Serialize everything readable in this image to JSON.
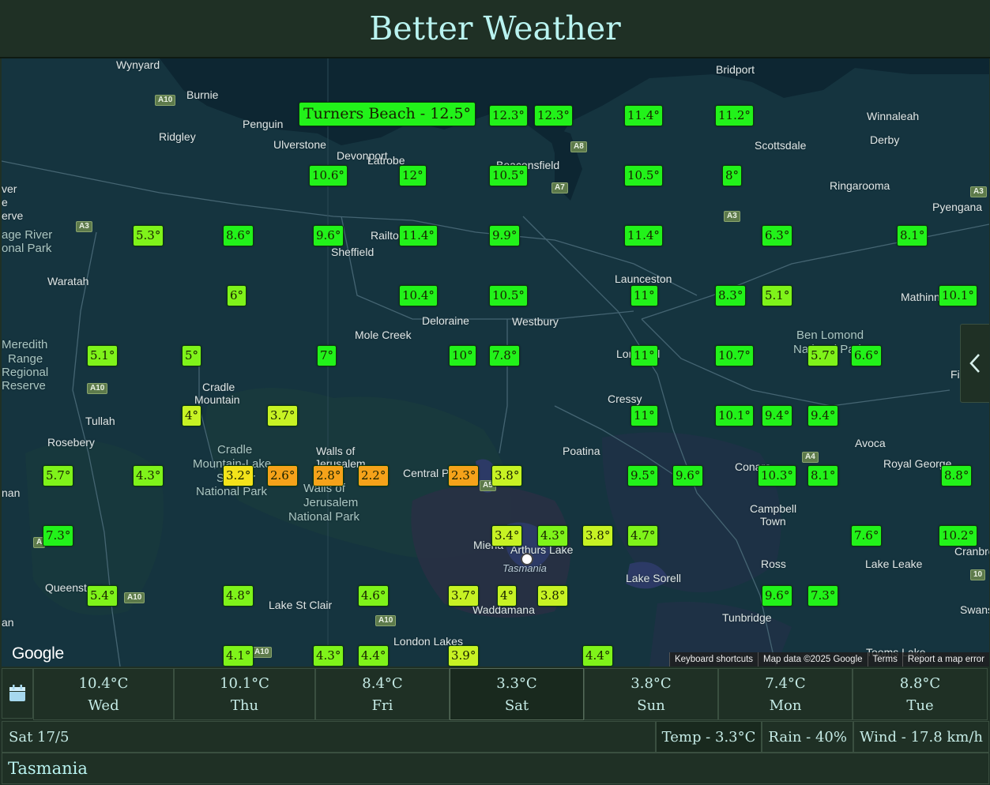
{
  "app": {
    "title": "Better Weather"
  },
  "map": {
    "colors": {
      "water": "#0f2a36",
      "land": "#12313c",
      "marker_green": "#22f21a",
      "marker_lime": "#7ff31a",
      "marker_yellowgreen": "#c7f224",
      "marker_yellow": "#f3e31a",
      "marker_orange": "#f5a21a"
    },
    "place_labels": [
      {
        "text": "Wynyard",
        "kind": "town"
      },
      {
        "text": "Burnie",
        "kind": "town"
      },
      {
        "text": "Penguin",
        "kind": "town"
      },
      {
        "text": "Ridgley",
        "kind": "town"
      },
      {
        "text": "Ulverstone",
        "kind": "town"
      },
      {
        "text": "Devonport",
        "kind": "town"
      },
      {
        "text": "Latrobe",
        "kind": "town"
      },
      {
        "text": "Beaconsfield",
        "kind": "town"
      },
      {
        "text": "Bridport",
        "kind": "town"
      },
      {
        "text": "Winnaleah",
        "kind": "town"
      },
      {
        "text": "Derby",
        "kind": "town"
      },
      {
        "text": "Scottsdale",
        "kind": "town"
      },
      {
        "text": "Ringarooma",
        "kind": "town"
      },
      {
        "text": "Pyengana",
        "kind": "town"
      },
      {
        "text": "ver",
        "kind": "town"
      },
      {
        "text": "e",
        "kind": "town"
      },
      {
        "text": "erve",
        "kind": "town"
      },
      {
        "text": "age River",
        "kind": "park"
      },
      {
        "text": "onal Park",
        "kind": "park"
      },
      {
        "text": "Railton",
        "kind": "town"
      },
      {
        "text": "Sheffield",
        "kind": "town"
      },
      {
        "text": "Waratah",
        "kind": "town"
      },
      {
        "text": "Launceston",
        "kind": "town"
      },
      {
        "text": "Mathinna",
        "kind": "town"
      },
      {
        "text": "Deloraine",
        "kind": "town"
      },
      {
        "text": "Westbury",
        "kind": "town"
      },
      {
        "text": "Mole Creek",
        "kind": "town"
      },
      {
        "text": "Ben Lomond",
        "kind": "park"
      },
      {
        "text": "National Park",
        "kind": "park"
      },
      {
        "text": "Meredith",
        "kind": "park"
      },
      {
        "text": "Range",
        "kind": "park"
      },
      {
        "text": "Regional",
        "kind": "park"
      },
      {
        "text": "Reserve",
        "kind": "park"
      },
      {
        "text": "Fingal",
        "kind": "town"
      },
      {
        "text": "Longford",
        "kind": "town"
      },
      {
        "text": "Cradle",
        "kind": "town"
      },
      {
        "text": "Mountain",
        "kind": "town"
      },
      {
        "text": "Tullah",
        "kind": "town"
      },
      {
        "text": "Cressy",
        "kind": "town"
      },
      {
        "text": "Rosebery",
        "kind": "town"
      },
      {
        "text": "Avoca",
        "kind": "town"
      },
      {
        "text": "Cradle",
        "kind": "park"
      },
      {
        "text": "Mountain-Lake",
        "kind": "park"
      },
      {
        "text": "St Clair",
        "kind": "park"
      },
      {
        "text": "National Park",
        "kind": "park"
      },
      {
        "text": "Walls of",
        "kind": "town"
      },
      {
        "text": "Jerusalem",
        "kind": "town"
      },
      {
        "text": "Walls of",
        "kind": "park"
      },
      {
        "text": "Jerusalem",
        "kind": "park"
      },
      {
        "text": "National Park",
        "kind": "park"
      },
      {
        "text": "Central Plateau",
        "kind": "town"
      },
      {
        "text": "Poatina",
        "kind": "town"
      },
      {
        "text": "Conara",
        "kind": "town"
      },
      {
        "text": "Royal George",
        "kind": "town"
      },
      {
        "text": "Campbell",
        "kind": "town"
      },
      {
        "text": "Town",
        "kind": "town"
      },
      {
        "text": "nan",
        "kind": "town"
      },
      {
        "text": "Miena",
        "kind": "town"
      },
      {
        "text": "Arthurs Lake",
        "kind": "town"
      },
      {
        "text": "Tasmania",
        "kind": "lake"
      },
      {
        "text": "Ross",
        "kind": "town"
      },
      {
        "text": "Lake Leake",
        "kind": "town"
      },
      {
        "text": "Cranbrook",
        "kind": "town"
      },
      {
        "text": "Lake Sorell",
        "kind": "town"
      },
      {
        "text": "Queenstown",
        "kind": "town"
      },
      {
        "text": "Lake St Clair",
        "kind": "town"
      },
      {
        "text": "Waddamana",
        "kind": "town"
      },
      {
        "text": "Tunbridge",
        "kind": "town"
      },
      {
        "text": "Swansea",
        "kind": "town"
      },
      {
        "text": "an",
        "kind": "town"
      },
      {
        "text": "London Lakes",
        "kind": "town"
      },
      {
        "text": "Tooms Lake",
        "kind": "town"
      }
    ],
    "road_shields": [
      "A10",
      "A8",
      "A7",
      "A3",
      "A3",
      "A10",
      "A10",
      "A5",
      "A4",
      "A10",
      "A3",
      "10",
      "A10",
      "A"
    ],
    "selected_location": {
      "label": "Turners Beach - 12.5°"
    },
    "markers": [
      {
        "label": "12.3°",
        "level": "green"
      },
      {
        "label": "12.3°",
        "level": "green"
      },
      {
        "label": "11.4°",
        "level": "green"
      },
      {
        "label": "11.2°",
        "level": "green"
      },
      {
        "label": "10.6°",
        "level": "green"
      },
      {
        "label": "12°",
        "level": "green"
      },
      {
        "label": "10.5°",
        "level": "green"
      },
      {
        "label": "10.5°",
        "level": "green"
      },
      {
        "label": "8°",
        "level": "green"
      },
      {
        "label": "5.3°",
        "level": "lime"
      },
      {
        "label": "8.6°",
        "level": "green"
      },
      {
        "label": "9.6°",
        "level": "green"
      },
      {
        "label": "11.4°",
        "level": "green"
      },
      {
        "label": "9.9°",
        "level": "green"
      },
      {
        "label": "11.4°",
        "level": "green"
      },
      {
        "label": "6.3°",
        "level": "green"
      },
      {
        "label": "8.1°",
        "level": "green"
      },
      {
        "label": "6°",
        "level": "lime"
      },
      {
        "label": "10.4°",
        "level": "green"
      },
      {
        "label": "10.5°",
        "level": "green"
      },
      {
        "label": "11°",
        "level": "green"
      },
      {
        "label": "8.3°",
        "level": "green"
      },
      {
        "label": "5.1°",
        "level": "lime"
      },
      {
        "label": "10.1°",
        "level": "green"
      },
      {
        "label": "5.1°",
        "level": "lime"
      },
      {
        "label": "5°",
        "level": "lime"
      },
      {
        "label": "7°",
        "level": "green"
      },
      {
        "label": "10°",
        "level": "green"
      },
      {
        "label": "7.8°",
        "level": "green"
      },
      {
        "label": "11°",
        "level": "green"
      },
      {
        "label": "10.7°",
        "level": "green"
      },
      {
        "label": "5.7°",
        "level": "lime"
      },
      {
        "label": "6.6°",
        "level": "green"
      },
      {
        "label": "4°",
        "level": "yellowgreen"
      },
      {
        "label": "3.7°",
        "level": "yellowgreen"
      },
      {
        "label": "11°",
        "level": "green"
      },
      {
        "label": "10.1°",
        "level": "green"
      },
      {
        "label": "9.4°",
        "level": "green"
      },
      {
        "label": "9.4°",
        "level": "green"
      },
      {
        "label": "5.7°",
        "level": "lime"
      },
      {
        "label": "4.3°",
        "level": "lime"
      },
      {
        "label": "3.2°",
        "level": "yellow"
      },
      {
        "label": "2.6°",
        "level": "orange"
      },
      {
        "label": "2.8°",
        "level": "orange"
      },
      {
        "label": "2.2°",
        "level": "orange"
      },
      {
        "label": "2.3°",
        "level": "orange"
      },
      {
        "label": "3.8°",
        "level": "yellowgreen"
      },
      {
        "label": "9.5°",
        "level": "green"
      },
      {
        "label": "9.6°",
        "level": "green"
      },
      {
        "label": "10.3°",
        "level": "green"
      },
      {
        "label": "8.1°",
        "level": "green"
      },
      {
        "label": "8.8°",
        "level": "green"
      },
      {
        "label": "7.3°",
        "level": "green"
      },
      {
        "label": "3.4°",
        "level": "yellowgreen"
      },
      {
        "label": "4.3°",
        "level": "lime"
      },
      {
        "label": "3.8°",
        "level": "yellowgreen"
      },
      {
        "label": "4.7°",
        "level": "lime"
      },
      {
        "label": "7.6°",
        "level": "green"
      },
      {
        "label": "10.2°",
        "level": "green"
      },
      {
        "label": "5.4°",
        "level": "lime"
      },
      {
        "label": "4.8°",
        "level": "lime"
      },
      {
        "label": "4.6°",
        "level": "lime"
      },
      {
        "label": "3.7°",
        "level": "yellowgreen"
      },
      {
        "label": "4°",
        "level": "yellowgreen"
      },
      {
        "label": "3.8°",
        "level": "yellowgreen"
      },
      {
        "label": "9.6°",
        "level": "green"
      },
      {
        "label": "7.3°",
        "level": "green"
      },
      {
        "label": "4.1°",
        "level": "lime"
      },
      {
        "label": "4.3°",
        "level": "lime"
      },
      {
        "label": "4.4°",
        "level": "lime"
      },
      {
        "label": "3.9°",
        "level": "yellowgreen"
      },
      {
        "label": "4.4°",
        "level": "lime"
      }
    ],
    "google_logo": "Google",
    "attribution": {
      "shortcuts": "Keyboard shortcuts",
      "map_data": "Map data ©2025 Google",
      "terms": "Terms",
      "report": "Report a map error"
    },
    "side_toggle_icon": "chevron-left-icon"
  },
  "forecast": {
    "calendar_icon": "calendar-icon",
    "days": [
      {
        "temp": "10.4°C",
        "name": "Wed",
        "selected": false
      },
      {
        "temp": "10.1°C",
        "name": "Thu",
        "selected": false
      },
      {
        "temp": "8.4°C",
        "name": "Fri",
        "selected": false
      },
      {
        "temp": "3.3°C",
        "name": "Sat",
        "selected": true
      },
      {
        "temp": "3.8°C",
        "name": "Sun",
        "selected": false
      },
      {
        "temp": "7.4°C",
        "name": "Mon",
        "selected": false
      },
      {
        "temp": "8.8°C",
        "name": "Tue",
        "selected": false
      }
    ]
  },
  "info": {
    "date": "Sat 17/5",
    "temp": "Temp - 3.3°C",
    "rain": "Rain - 40%",
    "wind": "Wind - 17.8 km/h"
  },
  "region": {
    "name": "Tasmania"
  }
}
